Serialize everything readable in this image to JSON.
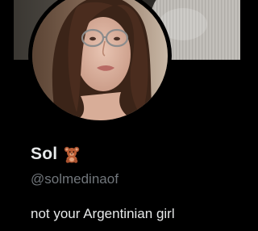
{
  "profile": {
    "name": "Sol",
    "name_emoji": "teddy-bear-icon",
    "handle": "@solmedinaof",
    "bio": "not your Argentinian girl"
  },
  "colors": {
    "background": "#000000",
    "primary_text": "#e7e9ea",
    "secondary_text": "#71767b"
  }
}
